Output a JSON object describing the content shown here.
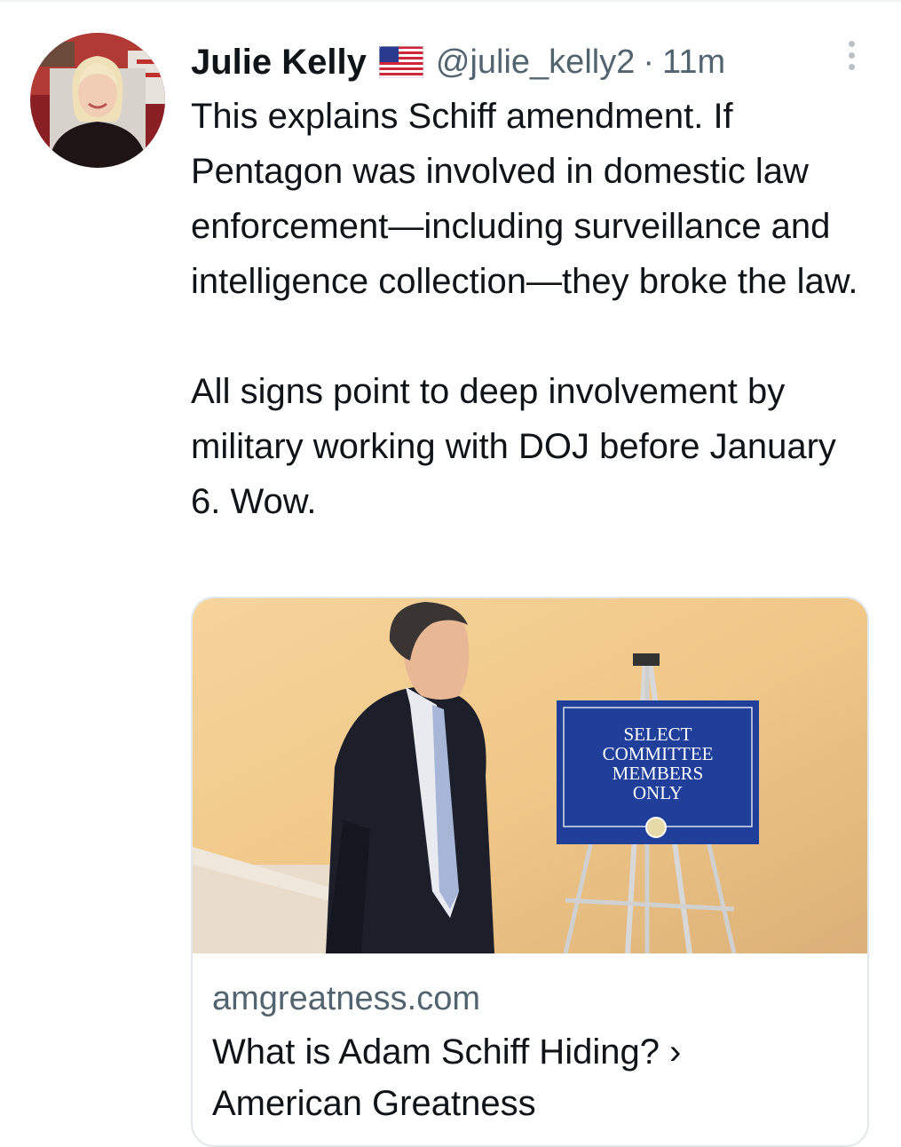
{
  "author": {
    "name": "Julie Kelly",
    "handle": "@julie_kelly2",
    "separator": "·",
    "time": "11m",
    "flag_icon": "us-flag-icon"
  },
  "tweet": {
    "paragraphs": [
      "This explains Schiff amendment. If Pentagon was involved in domestic law enforcement—including surveillance and intelligence collection—they broke the law.",
      "All signs point to deep involvement by military working with DOJ before January 6. Wow."
    ]
  },
  "card": {
    "domain": "amgreatness.com",
    "title": "What is Adam Schiff Hiding? ›",
    "site": "American Greatness",
    "sign_text": [
      "SELECT",
      "COMMITTEE",
      "MEMBERS",
      "ONLY"
    ]
  },
  "colors": {
    "text": "#0f1419",
    "secondary": "#536471",
    "border": "#e1e8ed",
    "sign_blue": "#1f3f9a"
  }
}
